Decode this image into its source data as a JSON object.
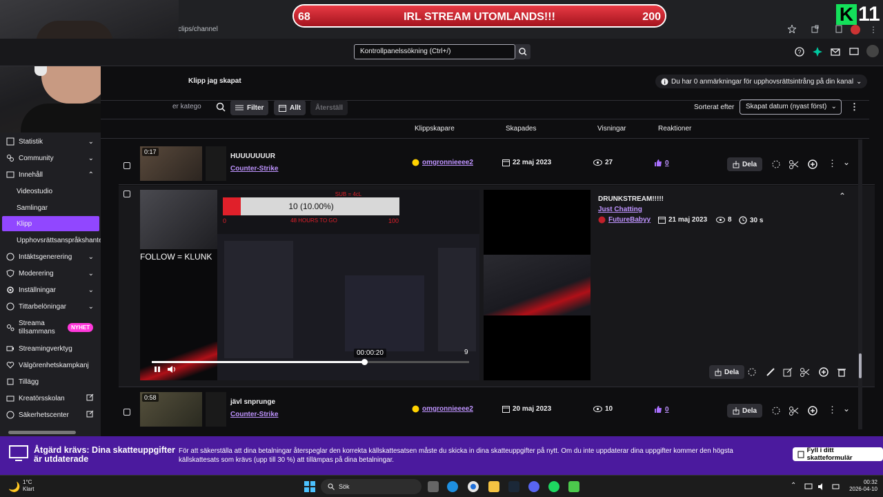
{
  "browser": {
    "url_fragment": "clips/channel"
  },
  "overlay": {
    "goal_left": "68",
    "goal_title": "IRL STREAM UTOMLANDS!!!",
    "goal_right": "200",
    "logo_text": "11"
  },
  "topbar": {
    "search_placeholder": "Kontrollpanelssökning (Ctrl+/)"
  },
  "page": {
    "tab_label": "Klipp jag skapat",
    "copyright_notice": "Du har 0 anmärkningar för upphovsrättsintrång på din kanal",
    "category_search_value": "er katego",
    "filter_label": "Filter",
    "date_label": "Allt",
    "reset_label": "Återställ",
    "sort_label": "Sorterat efter",
    "sort_value": "Skapat datum (nyast först)"
  },
  "columns": {
    "creator": "Klippskapare",
    "created": "Skapades",
    "views": "Visningar",
    "reactions": "Reaktioner"
  },
  "sidebar": {
    "items": [
      {
        "label": "Statistik",
        "icon": "chart-icon"
      },
      {
        "label": "Community",
        "icon": "community-icon"
      },
      {
        "label": "Innehåll",
        "icon": "content-icon"
      },
      {
        "label": "Videostudio"
      },
      {
        "label": "Samlingar"
      },
      {
        "label": "Klipp"
      },
      {
        "label": "Upphovsrättsanspråkshante"
      },
      {
        "label": "Intäktsgenerering",
        "icon": "money-icon"
      },
      {
        "label": "Moderering",
        "icon": "shield-icon"
      },
      {
        "label": "Inställningar",
        "icon": "gear-icon"
      },
      {
        "label": "Tittarbelöningar",
        "icon": "reward-icon"
      },
      {
        "label": "Streama tillsammans",
        "icon": "people-icon",
        "badge": "NYHET"
      },
      {
        "label": "Streamingverktyg",
        "icon": "camera-icon"
      },
      {
        "label": "Välgörenhetskampkanj",
        "icon": "heart-icon"
      },
      {
        "label": "Tillägg",
        "icon": "extension-icon"
      },
      {
        "label": "Kreatörsskolan",
        "icon": "school-icon"
      },
      {
        "label": "Säkerhetscenter",
        "icon": "safety-icon"
      }
    ]
  },
  "clips": [
    {
      "duration": "0:17",
      "title": "HUUUUUUUR",
      "category": "Counter-Strike",
      "creator": "omgronnieeee2",
      "date": "22 maj 2023",
      "views": "27",
      "reactions": "0",
      "share": "Dela"
    },
    {
      "title": "DRUNKSTREAM!!!!!",
      "category": "Just Chatting",
      "creator": "FutureBabyy",
      "date": "21 maj 2023",
      "views": "8",
      "length": "30 s",
      "share": "Dela",
      "player": {
        "sub_goal_text": "10 (10.00%)",
        "sub_goal_fraction": 0.1,
        "sub_header": "SUB = 4cL",
        "sub_low": "0",
        "sub_high": "100",
        "sub_timer": "48 HOURS TO GO",
        "follow_text": "FOLLOW = KLUNK",
        "timestamp": "00:00:20",
        "progress": 0.67,
        "counter": "9"
      }
    },
    {
      "duration": "0:58",
      "title": "jävl snprunge",
      "category": "Counter-Strike",
      "creator": "omgronnieeee2",
      "date": "20 maj 2023",
      "views": "10",
      "reactions": "0",
      "share": "Dela"
    }
  ],
  "banner": {
    "title": "Åtgärd krävs: Dina skatteuppgifter är utdaterade",
    "body": "För att säkerställa att dina betalningar återspeglar den korrekta källskattesatsen måste du skicka in dina skatteuppgifter på nytt. Om du inte uppdaterar dina uppgifter kommer den högsta källskattesats som krävs (upp till 30 %) att tillämpas på dina betalningar.",
    "button": "Fyll i ditt skatteformulär"
  },
  "taskbar": {
    "weather_temp": "1°C",
    "weather_text": "Klart",
    "search": "Sök",
    "time": "00:32",
    "date": "2026-04-10"
  },
  "colors": {
    "accent": "#9147ff",
    "link": "#bf94ff",
    "banner": "#4b1a9e",
    "goal_red": "#e0202a"
  }
}
